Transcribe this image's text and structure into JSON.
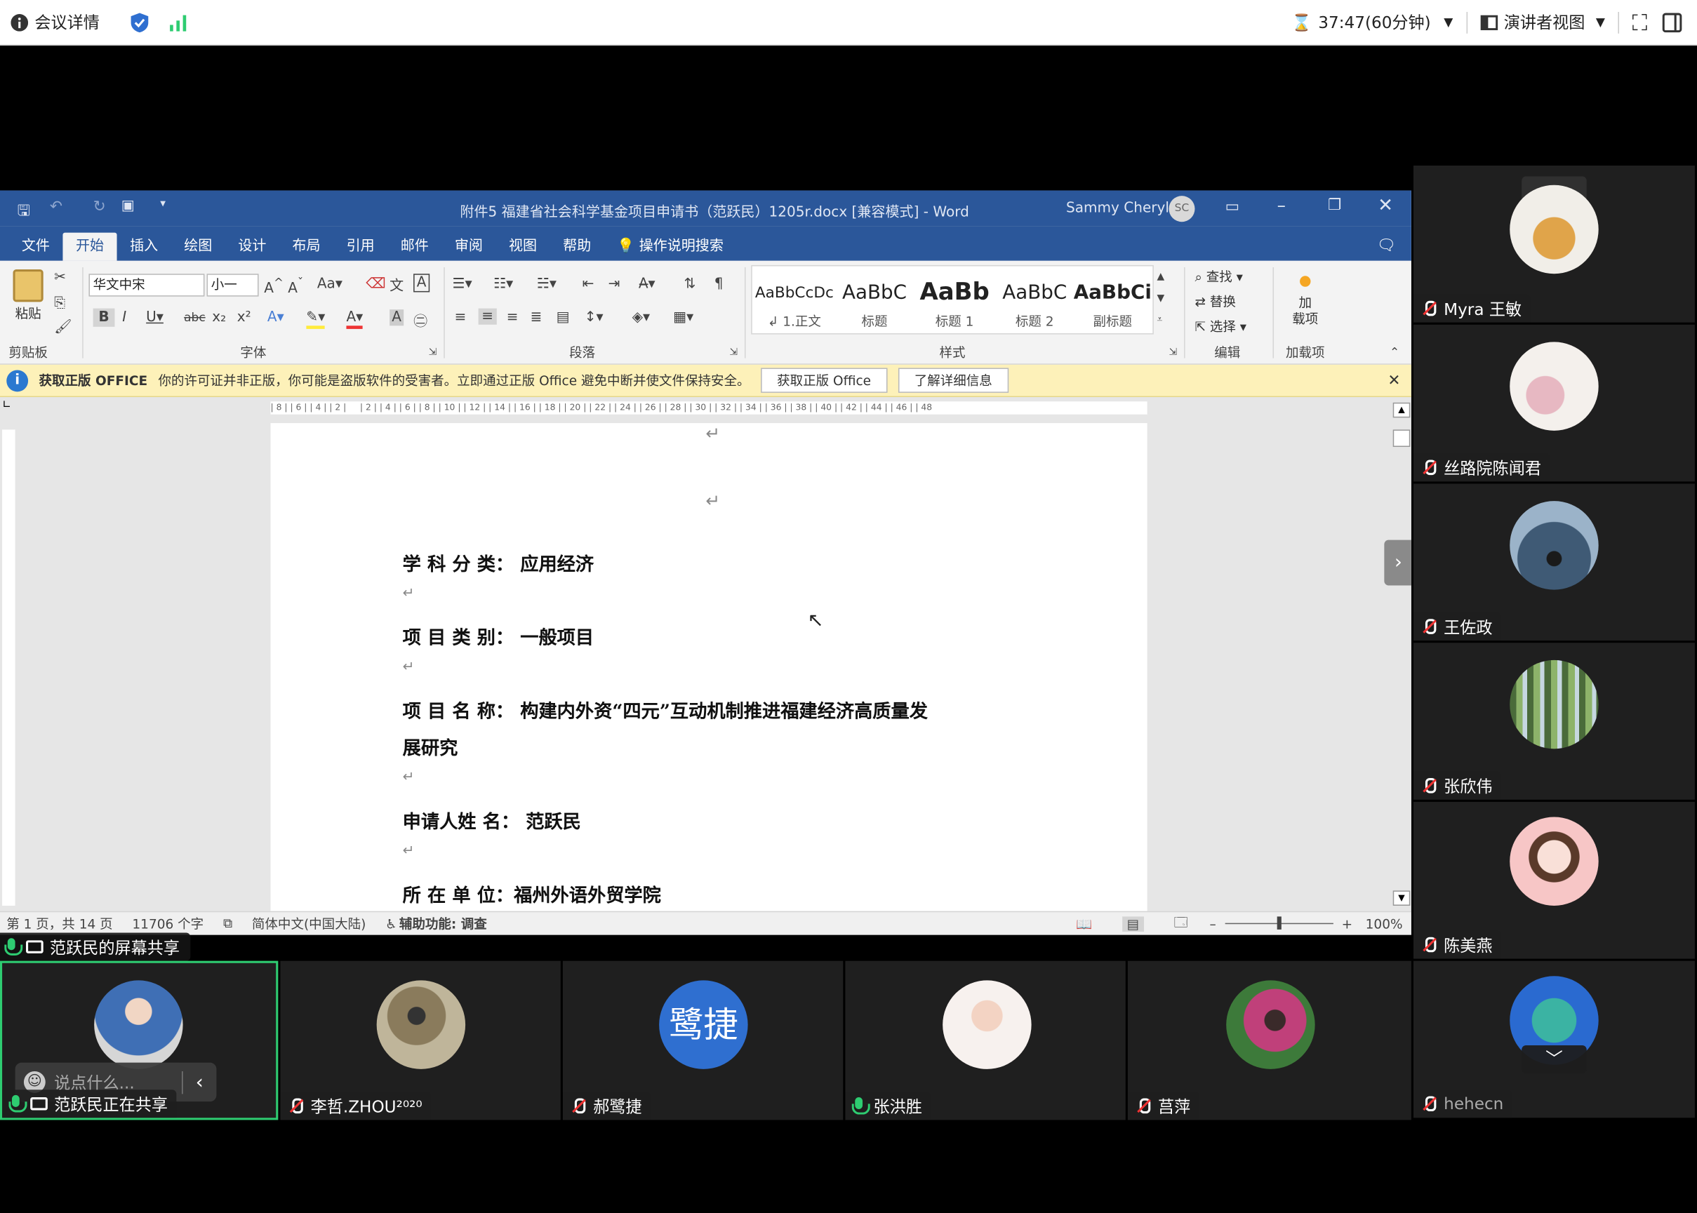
{
  "meeting": {
    "details_label": "会议详情",
    "timer": "37:47(60分钟)",
    "view_label": "演讲者视图"
  },
  "word": {
    "title": "附件5 福建省社会科学基金项目申请书（范跃民）1205r.docx [兼容模式] - Word",
    "user_name": "Sammy Cheryl",
    "user_initials": "SC",
    "menu": [
      "文件",
      "开始",
      "插入",
      "绘图",
      "设计",
      "布局",
      "引用",
      "邮件",
      "审阅",
      "视图",
      "帮助"
    ],
    "search_hint": "操作说明搜索",
    "font_name": "华文中宋",
    "font_size": "小一",
    "group_labels": {
      "clipboard": "剪贴板",
      "font": "字体",
      "paragraph": "段落",
      "styles": "样式",
      "edit": "编辑",
      "addins": "加载项"
    },
    "paste_label": "粘贴",
    "styles": [
      {
        "sample": "AaBbCcDc",
        "name": "↲ 1.正文"
      },
      {
        "sample": "AaBbC",
        "name": "标题"
      },
      {
        "sample": "AaBb",
        "name": "标题 1"
      },
      {
        "sample": "AaBbC",
        "name": "标题 2"
      },
      {
        "sample": "AaBbCi",
        "name": "副标题"
      }
    ],
    "edit_items": [
      "查找",
      "替换",
      "选择"
    ],
    "addin_label": "加载项",
    "addin_button": "加\n载项",
    "info_title": "获取正版 OFFICE",
    "info_text": "你的许可证并非正版，你可能是盗版软件的受害者。立即通过正版 Office 避免中断并使文件保持安全。",
    "info_btn1": "获取正版 Office",
    "info_btn2": "了解详细信息",
    "doc_lines": [
      "学 科 分 类： 应用经济",
      "项 目 类 别： 一般项目",
      "项 目 名 称： 构建内外资“四元”互动机制推进福建经济高质量发",
      "展研究",
      "申请人姓 名： 范跃民",
      "所 在 单 位：福州外语外贸学院"
    ],
    "status": {
      "page": "第 1 页，共 14 页",
      "words": "11706 个字",
      "language": "简体中文(中国大陆)",
      "accessibility": "辅助功能: 调查",
      "zoom": "100%"
    }
  },
  "share_label": "范跃民的屏幕共享",
  "chat_placeholder": "说点什么...",
  "bottom_participants": [
    {
      "name": "范跃民正在共享",
      "mic": "on"
    },
    {
      "name": "李哲.ZHOU²⁰²⁰",
      "mic": "off"
    },
    {
      "name": "郝鹭捷",
      "mic": "off",
      "initials": "鹭捷"
    },
    {
      "name": "张洪胜",
      "mic": "on"
    },
    {
      "name": "莒萍",
      "mic": "off"
    }
  ],
  "side_participants": [
    {
      "name": "Myra 王敏",
      "mic": "off"
    },
    {
      "name": "丝路院陈闻君",
      "mic": "off"
    },
    {
      "name": "王佐政",
      "mic": "off"
    },
    {
      "name": "张欣伟",
      "mic": "off"
    },
    {
      "name": "陈美燕",
      "mic": "off"
    },
    {
      "name": "hehecn",
      "mic": "off"
    }
  ],
  "colors": {
    "word_blue": "#2b579a",
    "infobar": "#fdf1b9",
    "active_tile_border": "#2ecc71",
    "avatar_blue": "#2f6fd0"
  }
}
